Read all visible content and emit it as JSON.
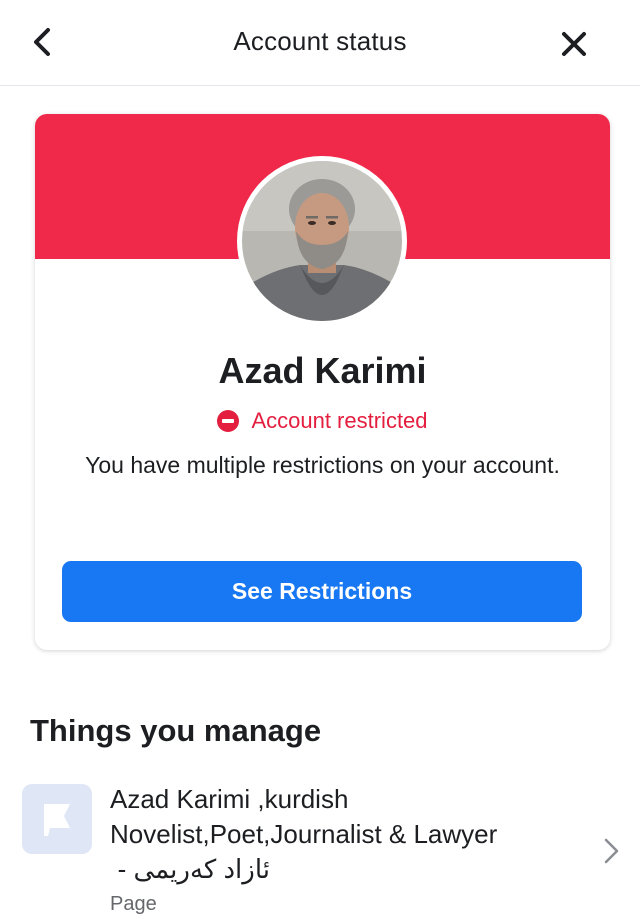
{
  "header": {
    "title": "Account status",
    "back_icon": "chevron-left-icon",
    "close_icon": "close-icon"
  },
  "card": {
    "banner_color": "#f02849",
    "name": "Azad Karimi",
    "status": {
      "icon": "minus-circle-icon",
      "text": "Account restricted",
      "color": "#e41e3f"
    },
    "description": "You have multiple restrictions on your account.",
    "button_label": "See Restrictions",
    "button_color": "#1877f2"
  },
  "manage": {
    "title": "Things you manage",
    "items": [
      {
        "icon": "flag-icon",
        "title": "Azad Karimi ,kurdish Novelist,Poet,Journalist & Lawyer",
        "title_rtl": "ئازاد کەریمی -",
        "subtitle": "Page",
        "chevron": "chevron-right-icon"
      }
    ]
  }
}
